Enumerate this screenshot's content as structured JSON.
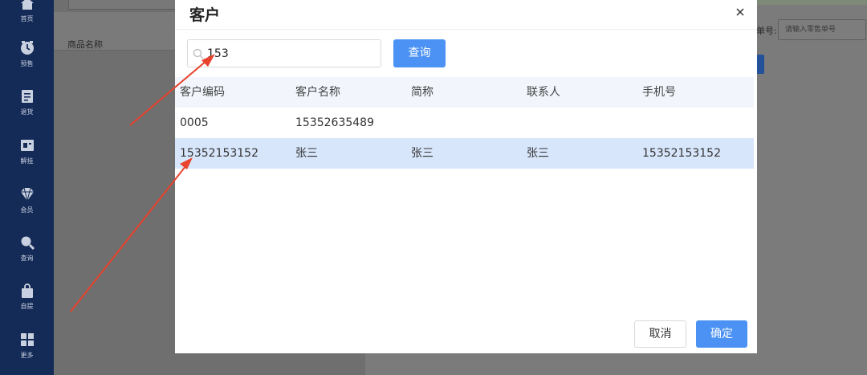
{
  "sidebar": {
    "items": [
      {
        "label": "首页",
        "icon": "home-icon"
      },
      {
        "label": "预售",
        "icon": "clock-icon"
      },
      {
        "label": "退货",
        "icon": "document-icon"
      },
      {
        "label": "解挂",
        "icon": "ticket-icon"
      },
      {
        "label": "会员",
        "icon": "diamond-icon"
      },
      {
        "label": "查询",
        "icon": "search-icon"
      },
      {
        "label": "自提",
        "icon": "bag-icon"
      },
      {
        "label": "更多",
        "icon": "grid-icon"
      }
    ]
  },
  "background": {
    "column_product_name": "商品名称",
    "order_label": "单号:",
    "order_placeholder": "请输入零售单号"
  },
  "modal": {
    "title": "客户",
    "close_label": "×",
    "search_value": "153",
    "query_label": "查询",
    "columns": [
      "客户编码",
      "客户名称",
      "简称",
      "联系人",
      "手机号"
    ],
    "rows": [
      [
        "0005",
        "15352635489",
        "",
        "",
        ""
      ],
      [
        "15352153152",
        "张三",
        "张三",
        "张三",
        "15352153152"
      ]
    ],
    "selected_row": 1,
    "cancel_label": "取消",
    "confirm_label": "确定"
  },
  "colors": {
    "sidebar": "#142a57",
    "primary": "#4b92f4",
    "selected_row": "#d8e6fb",
    "annotation_arrow": "#e8432c"
  }
}
